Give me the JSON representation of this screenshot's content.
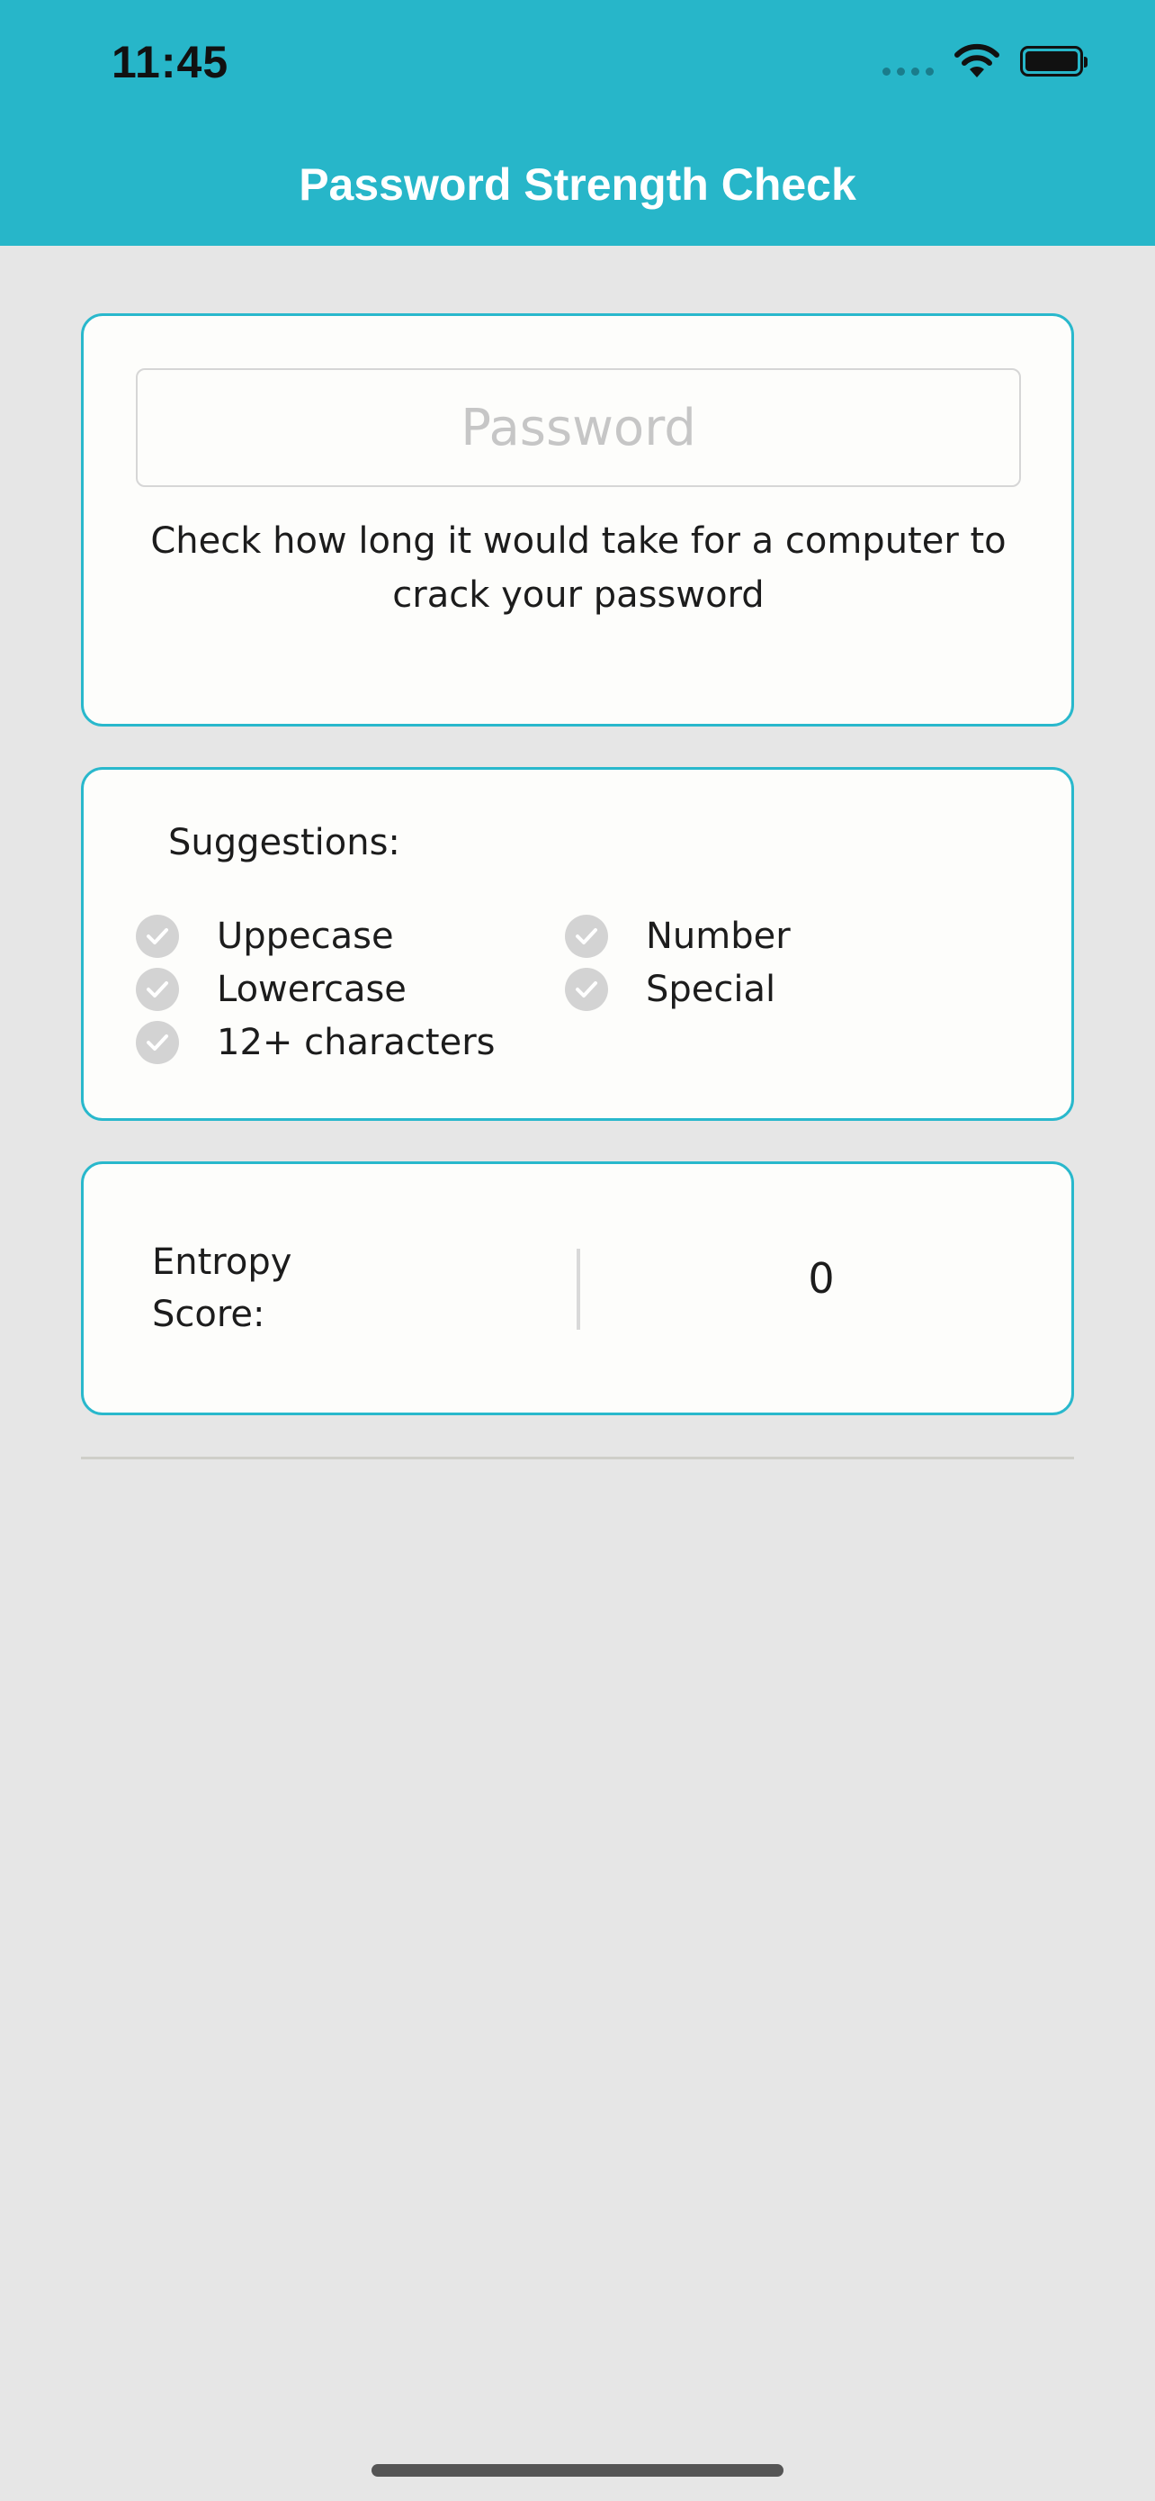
{
  "status_bar": {
    "time": "11:45",
    "icons": [
      "signal-dots-icon",
      "wifi-icon",
      "battery-icon"
    ]
  },
  "header": {
    "title": "Password Strength Check",
    "background_color": "#27b6c9"
  },
  "password_card": {
    "placeholder": "Password",
    "value": "",
    "description": "Check how long it would take for a computer to crack your password"
  },
  "suggestions": {
    "title": "Suggestions:",
    "items": [
      {
        "label": "Uppecase",
        "met": false
      },
      {
        "label": "Lowercase",
        "met": false
      },
      {
        "label": "12+ characters",
        "met": false
      },
      {
        "label": "Number",
        "met": false
      },
      {
        "label": "Special",
        "met": false
      }
    ]
  },
  "entropy": {
    "label": "Entropy Score:",
    "value": "0"
  },
  "colors": {
    "accent": "#29b8cc",
    "card_background": "#fdfdfb",
    "page_background": "#e6e6e6",
    "check_inactive": "#d3d3d3"
  }
}
